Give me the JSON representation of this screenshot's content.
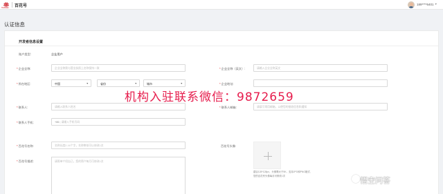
{
  "topbar": {
    "logo_text": "HUAWEI",
    "brand": "百花号",
    "user_id": "189****6401",
    "user_caret": "▼"
  },
  "page_title": "认证信息",
  "section_title": "开发者信息设置",
  "fields": {
    "account_type": {
      "label": "账户类型:",
      "value": "企业用户"
    },
    "company_name": {
      "label": "企业全称:",
      "placeholder": "企业全称需与营业执照上名称保持一致"
    },
    "company_name_en": {
      "label": "企业全称（英文）:",
      "placeholder": "请输入企业全称英文"
    },
    "region": {
      "label": "所在地区:",
      "country": "中国",
      "province": "省份",
      "city": "城市"
    },
    "company_address": {
      "label": "企业地址:",
      "placeholder": ""
    },
    "contact": {
      "label": "联系人:",
      "placeholder": "请输入联系人姓名"
    },
    "contact_email": {
      "label": "联系人邮箱:",
      "placeholder": "请填写常用邮箱，以便您的接收信息和通知"
    },
    "contact_phone": {
      "label": "联系人手机:",
      "prefix": "+86",
      "placeholder": "请输入手机号码"
    },
    "account_name": {
      "label": "百花号名称:",
      "placeholder": "名称长度2-16个字，名称审核可以修改1次"
    },
    "account_avatar": {
      "label": "百花号头像:",
      "hint_lines": [
        "建议128*128px，头像需大于5K，支持JPG和PNG格式,",
        "您的百花号头像每月可修改1次"
      ]
    },
    "account_desc": {
      "label": "百花号描述:",
      "placeholder": "请简单介绍自己，您的简介每月可修改1次"
    }
  },
  "watermark": "机构入驻联系微信：9872659",
  "corner_mark": "悟空问答",
  "colors": {
    "required": "#e02020",
    "brand_red": "#c7000b",
    "watermark": "#e61c4c"
  }
}
